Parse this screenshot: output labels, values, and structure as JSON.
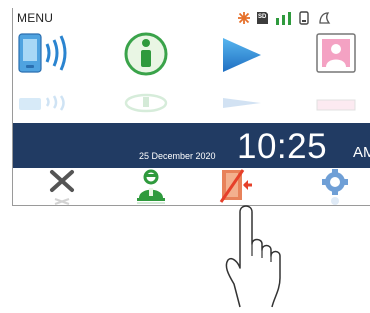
{
  "screen": {
    "menu_label": "MENU"
  },
  "status_bar": {
    "icons": [
      "no-tone-icon",
      "sd-card-icon",
      "signal-bars-icon",
      "battery-icon",
      "notification-icon"
    ],
    "sd_label": "SD"
  },
  "menu_icons": [
    "handset-wireless-icon",
    "info-icon",
    "play-icon",
    "contact-card-icon"
  ],
  "clock": {
    "date": "25 December 2020",
    "time": "10:25",
    "ampm": "AM"
  },
  "bottom_icons": [
    "close-x-icon",
    "caretaker-icon",
    "door-forbidden-icon",
    "settings-gear-icon"
  ],
  "colors": {
    "bar": "#213b63",
    "accent_red": "#e6402a",
    "accent_green": "#2f9a3d"
  }
}
